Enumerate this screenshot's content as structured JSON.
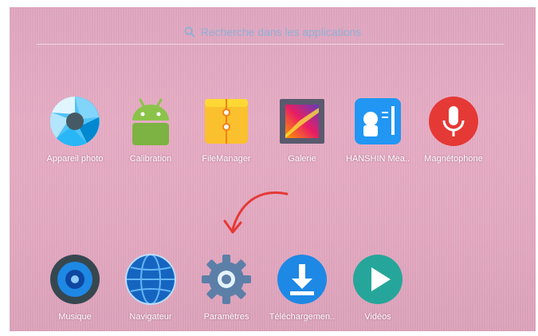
{
  "search": {
    "placeholder": "Recherche dans les applications",
    "icon": "search-icon"
  },
  "apps_row1": [
    {
      "name": "appareil-photo",
      "label": "Appareil photo",
      "icon": "camera-aperture-icon"
    },
    {
      "name": "calibration",
      "label": "Calibration",
      "icon": "android-robot-icon"
    },
    {
      "name": "filemanager",
      "label": "FileManager",
      "icon": "folder-zip-icon"
    },
    {
      "name": "galerie",
      "label": "Galerie",
      "icon": "gallery-icon"
    },
    {
      "name": "hanshin",
      "label": "HANSHIN Mea..",
      "icon": "hanshin-icon"
    },
    {
      "name": "magnetophone",
      "label": "Magnétophone",
      "icon": "microphone-icon"
    }
  ],
  "apps_row2": [
    {
      "name": "musique",
      "label": "Musique",
      "icon": "speaker-icon"
    },
    {
      "name": "navigateur",
      "label": "Navigateur",
      "icon": "globe-icon"
    },
    {
      "name": "parametres",
      "label": "Paramètres",
      "icon": "gear-icon"
    },
    {
      "name": "telechargements",
      "label": "Téléchargemen..",
      "icon": "download-icon"
    },
    {
      "name": "videos",
      "label": "Vidéos",
      "icon": "play-icon"
    }
  ],
  "annotation": {
    "icon": "red-curved-arrow-icon",
    "color": "#e53935"
  }
}
